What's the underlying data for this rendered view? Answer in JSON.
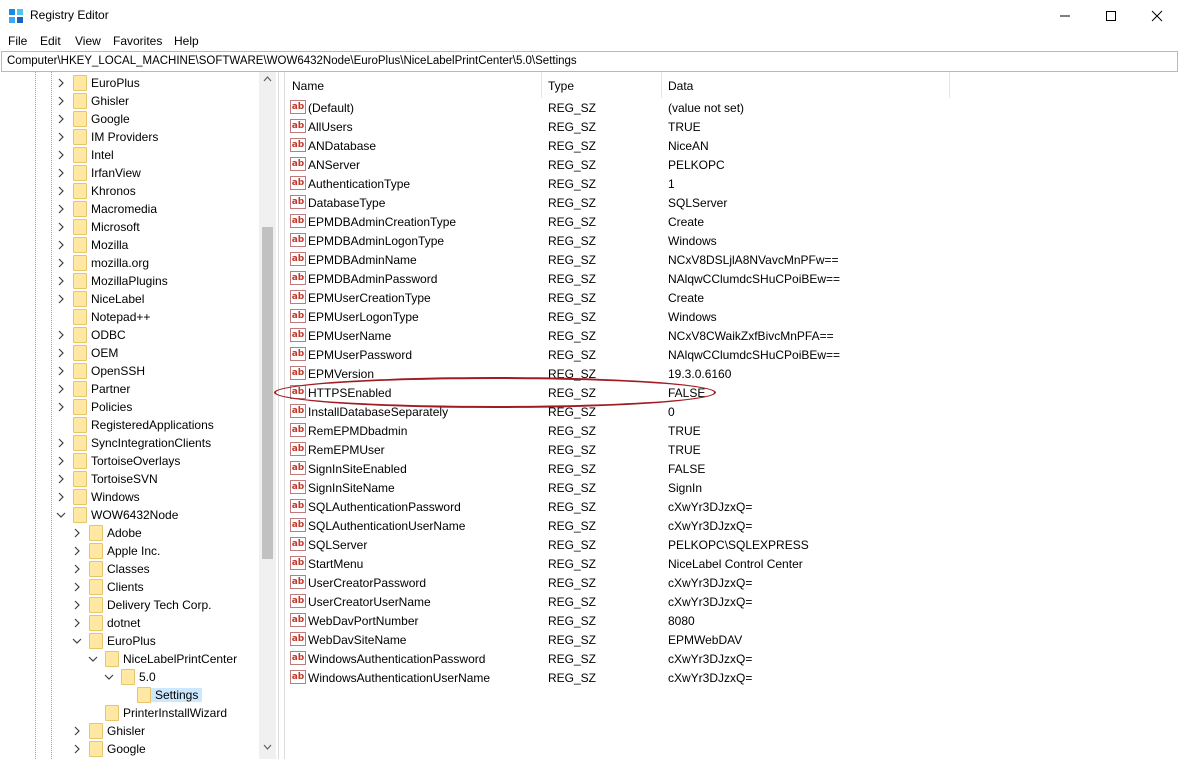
{
  "window": {
    "title": "Registry Editor"
  },
  "menu": [
    "File",
    "Edit",
    "View",
    "Favorites",
    "Help"
  ],
  "address": "Computer\\HKEY_LOCAL_MACHINE\\SOFTWARE\\WOW6432Node\\EuroPlus\\NiceLabelPrintCenter\\5.0\\Settings",
  "tree": [
    {
      "label": "EuroPlus",
      "level": 1,
      "expanded": false
    },
    {
      "label": "Ghisler",
      "level": 1,
      "expanded": false
    },
    {
      "label": "Google",
      "level": 1,
      "expanded": false
    },
    {
      "label": "IM Providers",
      "level": 1,
      "expanded": false
    },
    {
      "label": "Intel",
      "level": 1,
      "expanded": false
    },
    {
      "label": "IrfanView",
      "level": 1,
      "expanded": false
    },
    {
      "label": "Khronos",
      "level": 1,
      "expanded": false
    },
    {
      "label": "Macromedia",
      "level": 1,
      "expanded": false
    },
    {
      "label": "Microsoft",
      "level": 1,
      "expanded": false
    },
    {
      "label": "Mozilla",
      "level": 1,
      "expanded": false
    },
    {
      "label": "mozilla.org",
      "level": 1,
      "expanded": false
    },
    {
      "label": "MozillaPlugins",
      "level": 1,
      "expanded": false
    },
    {
      "label": "NiceLabel",
      "level": 1,
      "expanded": false
    },
    {
      "label": "Notepad++",
      "level": 1,
      "expanded": null
    },
    {
      "label": "ODBC",
      "level": 1,
      "expanded": false
    },
    {
      "label": "OEM",
      "level": 1,
      "expanded": false
    },
    {
      "label": "OpenSSH",
      "level": 1,
      "expanded": false
    },
    {
      "label": "Partner",
      "level": 1,
      "expanded": false
    },
    {
      "label": "Policies",
      "level": 1,
      "expanded": false
    },
    {
      "label": "RegisteredApplications",
      "level": 1,
      "expanded": null
    },
    {
      "label": "SyncIntegrationClients",
      "level": 1,
      "expanded": false
    },
    {
      "label": "TortoiseOverlays",
      "level": 1,
      "expanded": false
    },
    {
      "label": "TortoiseSVN",
      "level": 1,
      "expanded": false
    },
    {
      "label": "Windows",
      "level": 1,
      "expanded": false
    },
    {
      "label": "WOW6432Node",
      "level": 1,
      "expanded": true
    },
    {
      "label": "Adobe",
      "level": 2,
      "expanded": false
    },
    {
      "label": "Apple Inc.",
      "level": 2,
      "expanded": false
    },
    {
      "label": "Classes",
      "level": 2,
      "expanded": false
    },
    {
      "label": "Clients",
      "level": 2,
      "expanded": false
    },
    {
      "label": "Delivery Tech Corp.",
      "level": 2,
      "expanded": false
    },
    {
      "label": "dotnet",
      "level": 2,
      "expanded": false
    },
    {
      "label": "EuroPlus",
      "level": 2,
      "expanded": true
    },
    {
      "label": "NiceLabelPrintCenter",
      "level": 3,
      "expanded": true
    },
    {
      "label": "5.0",
      "level": 4,
      "expanded": true
    },
    {
      "label": "Settings",
      "level": 5,
      "expanded": null,
      "selected": true
    },
    {
      "label": "PrinterInstallWizard",
      "level": 3,
      "expanded": null
    },
    {
      "label": "Ghisler",
      "level": 2,
      "expanded": false
    },
    {
      "label": "Google",
      "level": 2,
      "expanded": false
    }
  ],
  "columns": {
    "name": "Name",
    "type": "Type",
    "data": "Data"
  },
  "values": [
    {
      "name": "(Default)",
      "type": "REG_SZ",
      "data": "(value not set)"
    },
    {
      "name": "AllUsers",
      "type": "REG_SZ",
      "data": "TRUE"
    },
    {
      "name": "ANDatabase",
      "type": "REG_SZ",
      "data": "NiceAN"
    },
    {
      "name": "ANServer",
      "type": "REG_SZ",
      "data": "PELKOPC"
    },
    {
      "name": "AuthenticationType",
      "type": "REG_SZ",
      "data": "1"
    },
    {
      "name": "DatabaseType",
      "type": "REG_SZ",
      "data": "SQLServer"
    },
    {
      "name": "EPMDBAdminCreationType",
      "type": "REG_SZ",
      "data": "Create"
    },
    {
      "name": "EPMDBAdminLogonType",
      "type": "REG_SZ",
      "data": "Windows"
    },
    {
      "name": "EPMDBAdminName",
      "type": "REG_SZ",
      "data": "NCxV8DSLjlA8NVavcMnPFw=="
    },
    {
      "name": "EPMDBAdminPassword",
      "type": "REG_SZ",
      "data": "NAlqwCClumdcSHuCPoiBEw=="
    },
    {
      "name": "EPMUserCreationType",
      "type": "REG_SZ",
      "data": "Create"
    },
    {
      "name": "EPMUserLogonType",
      "type": "REG_SZ",
      "data": "Windows"
    },
    {
      "name": "EPMUserName",
      "type": "REG_SZ",
      "data": "NCxV8CWaikZxfBivcMnPFA=="
    },
    {
      "name": "EPMUserPassword",
      "type": "REG_SZ",
      "data": "NAlqwCClumdcSHuCPoiBEw=="
    },
    {
      "name": "EPMVersion",
      "type": "REG_SZ",
      "data": "19.3.0.6160"
    },
    {
      "name": "HTTPSEnabled",
      "type": "REG_SZ",
      "data": "FALSE",
      "highlighted": true
    },
    {
      "name": "InstallDatabaseSeparately",
      "type": "REG_SZ",
      "data": "0"
    },
    {
      "name": "RemEPMDbadmin",
      "type": "REG_SZ",
      "data": "TRUE"
    },
    {
      "name": "RemEPMUser",
      "type": "REG_SZ",
      "data": "TRUE"
    },
    {
      "name": "SignInSiteEnabled",
      "type": "REG_SZ",
      "data": "FALSE"
    },
    {
      "name": "SignInSiteName",
      "type": "REG_SZ",
      "data": "SignIn"
    },
    {
      "name": "SQLAuthenticationPassword",
      "type": "REG_SZ",
      "data": "cXwYr3DJzxQ="
    },
    {
      "name": "SQLAuthenticationUserName",
      "type": "REG_SZ",
      "data": "cXwYr3DJzxQ="
    },
    {
      "name": "SQLServer",
      "type": "REG_SZ",
      "data": "PELKOPC\\SQLEXPRESS"
    },
    {
      "name": "StartMenu",
      "type": "REG_SZ",
      "data": "NiceLabel Control Center"
    },
    {
      "name": "UserCreatorPassword",
      "type": "REG_SZ",
      "data": "cXwYr3DJzxQ="
    },
    {
      "name": "UserCreatorUserName",
      "type": "REG_SZ",
      "data": "cXwYr3DJzxQ="
    },
    {
      "name": "WebDavPortNumber",
      "type": "REG_SZ",
      "data": "8080"
    },
    {
      "name": "WebDavSiteName",
      "type": "REG_SZ",
      "data": "EPMWebDAV"
    },
    {
      "name": "WindowsAuthenticationPassword",
      "type": "REG_SZ",
      "data": "cXwYr3DJzxQ="
    },
    {
      "name": "WindowsAuthenticationUserName",
      "type": "REG_SZ",
      "data": "cXwYr3DJzxQ="
    }
  ],
  "icons": {
    "app": "registry-editor-icon",
    "folder": "folder-icon",
    "value": "string-value-icon",
    "expand": "chevron-right-icon",
    "collapse": "chevron-down-icon"
  },
  "colors": {
    "selection": "#cce8ff",
    "annotation": "#a01c24",
    "folder": "#ffe8a4"
  }
}
